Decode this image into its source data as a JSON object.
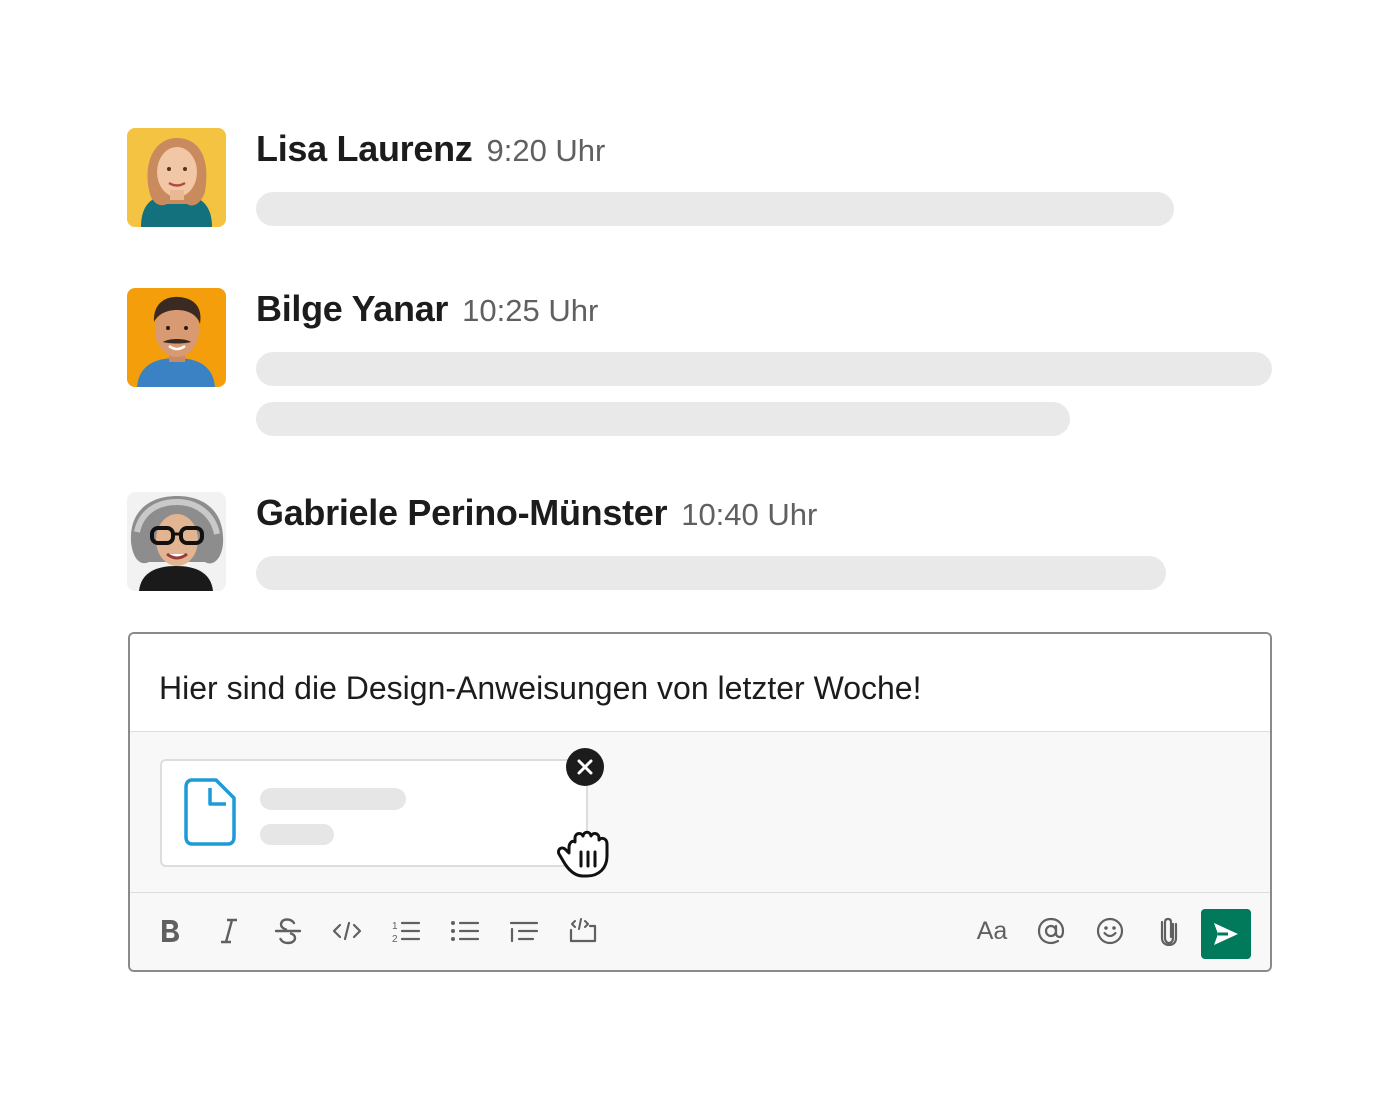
{
  "messages": [
    {
      "name": "Lisa Laurenz",
      "time": "9:20 Uhr"
    },
    {
      "name": "Bilge Yanar",
      "time": "10:25 Uhr"
    },
    {
      "name": "Gabriele Perino-Münster",
      "time": "10:40 Uhr"
    }
  ],
  "composer": {
    "text": "Hier sind die Design-Anweisungen von letzter Woche!",
    "toolbar": {
      "formatting_label": "Aa"
    }
  },
  "colors": {
    "send_button": "#007a5a",
    "file_icon": "#1e9bd7",
    "placeholder_bar": "#e9e9e9",
    "avatar_lisa_bg": "#f5c342",
    "avatar_bilge_bg": "#f59e0b"
  },
  "icons": [
    "bold-icon",
    "italic-icon",
    "strikethrough-icon",
    "code-icon",
    "numbered-list-icon",
    "bulleted-list-icon",
    "quote-icon",
    "code-block-icon",
    "at-mention-icon",
    "emoji-icon",
    "paperclip-icon",
    "send-icon",
    "file-icon",
    "close-icon",
    "grab-cursor-icon"
  ]
}
